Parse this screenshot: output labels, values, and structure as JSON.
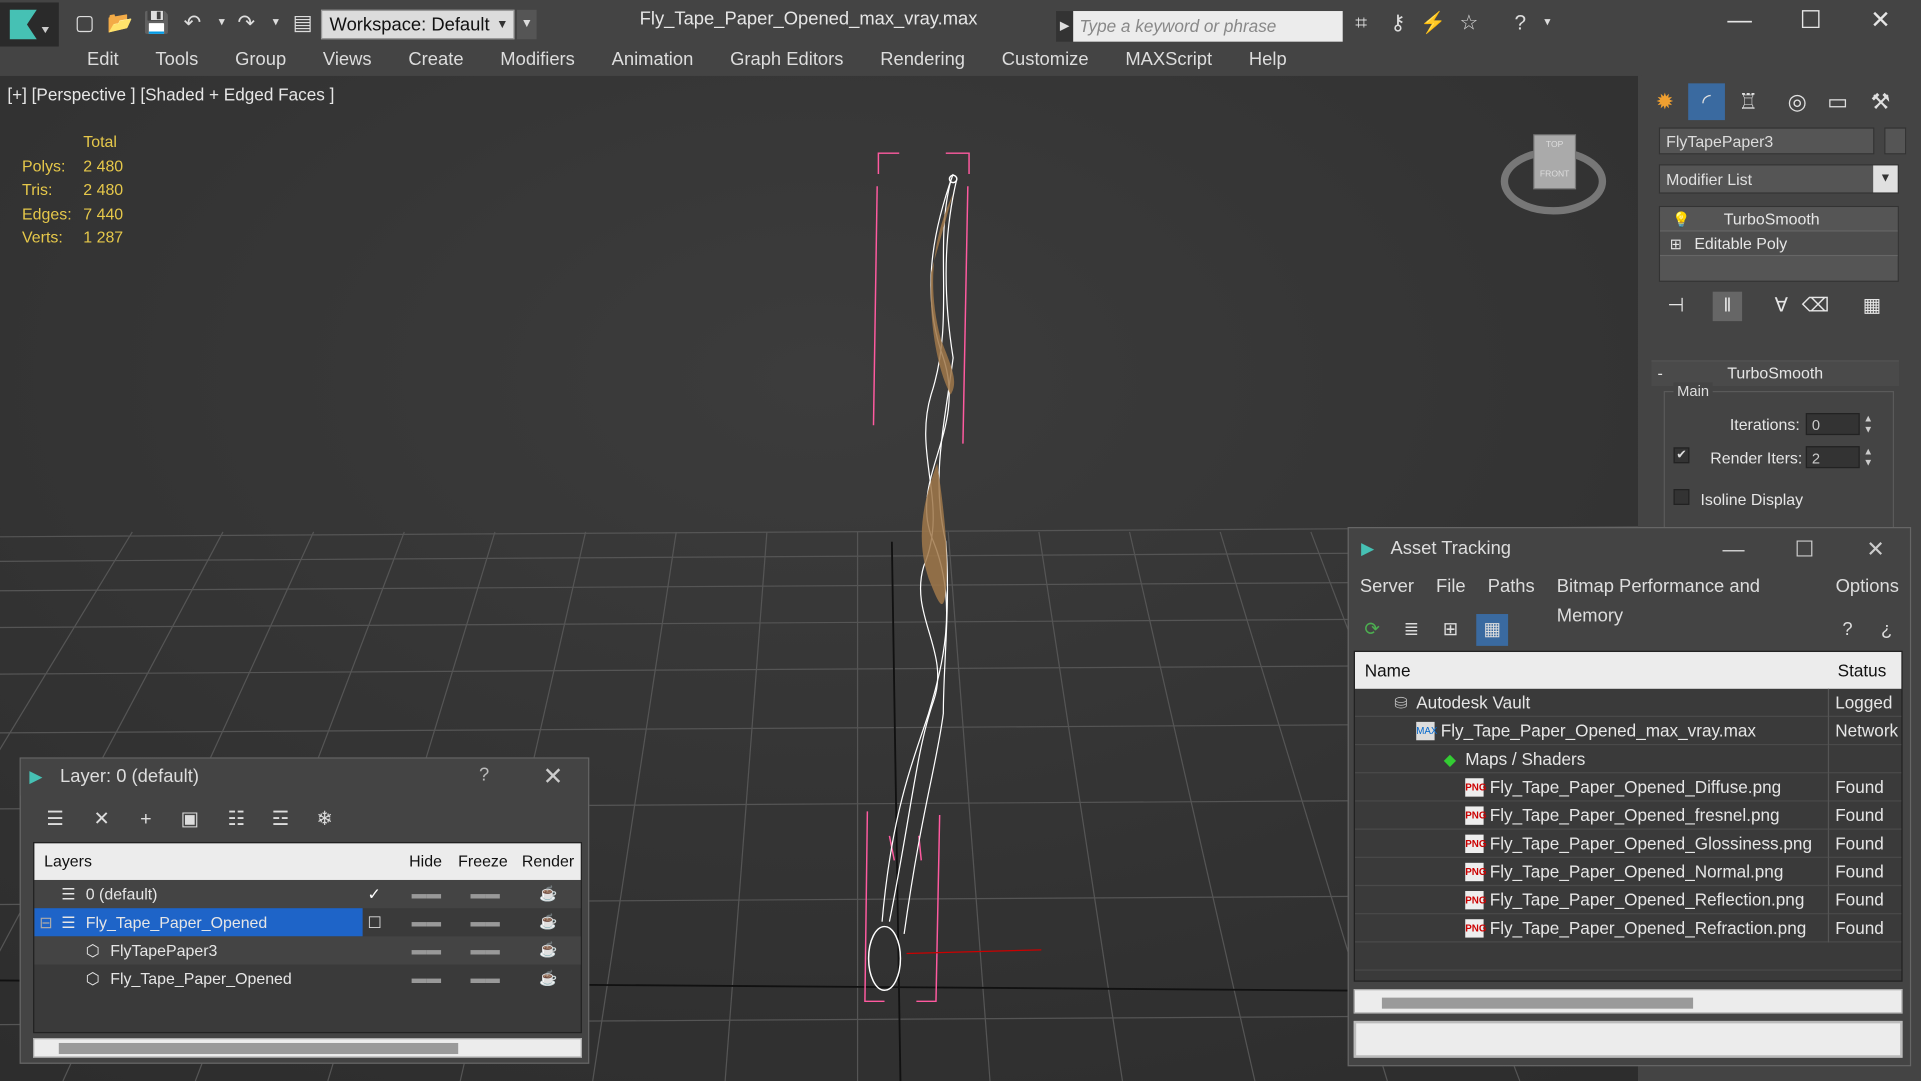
{
  "titlebar": {
    "workspace_label": "Workspace: Default",
    "doc_title": "Fly_Tape_Paper_Opened_max_vray.max",
    "search_placeholder": "Type a keyword or phrase"
  },
  "menu": [
    "Edit",
    "Tools",
    "Group",
    "Views",
    "Create",
    "Modifiers",
    "Animation",
    "Graph Editors",
    "Rendering",
    "Customize",
    "MAXScript",
    "Help"
  ],
  "viewport": {
    "label": "[+] [Perspective ] [Shaded + Edged Faces ]",
    "stats_header": "Total",
    "stats": [
      {
        "label": "Polys:",
        "value": "2 480"
      },
      {
        "label": "Tris:",
        "value": "2 480"
      },
      {
        "label": "Edges:",
        "value": "7 440"
      },
      {
        "label": "Verts:",
        "value": "1 287"
      }
    ],
    "viewcube_top": "TOP",
    "viewcube_front": "FRONT"
  },
  "command_panel": {
    "object_name": "FlyTapePaper3",
    "modifier_list": "Modifier List",
    "stack": [
      "TurboSmooth",
      "Editable Poly"
    ],
    "rollout_title": "TurboSmooth",
    "group_title": "Main",
    "iterations_label": "Iterations:",
    "iterations_value": "0",
    "render_iters_label": "Render Iters:",
    "render_iters_value": "2",
    "isoline_label": "Isoline Display"
  },
  "layer_dialog": {
    "title": "Layer: 0 (default)",
    "help": "?",
    "columns": [
      "Layers",
      "Hide",
      "Freeze",
      "Render"
    ],
    "rows": [
      {
        "name": "0 (default)",
        "indent": 1,
        "selected": false,
        "current": true
      },
      {
        "name": "Fly_Tape_Paper_Opened",
        "indent": 1,
        "selected": true,
        "current": false
      },
      {
        "name": "FlyTapePaper3",
        "indent": 2,
        "selected": false,
        "current": false
      },
      {
        "name": "Fly_Tape_Paper_Opened",
        "indent": 2,
        "selected": false,
        "current": false
      }
    ]
  },
  "asset_dialog": {
    "title": "Asset Tracking",
    "menu": [
      "Server",
      "File",
      "Paths",
      "Bitmap Performance and Memory",
      "Options"
    ],
    "columns": [
      "Name",
      "Status"
    ],
    "rows": [
      {
        "name": "Autodesk Vault",
        "status": "Logged",
        "indent": 0,
        "icon": "vault-icon"
      },
      {
        "name": "Fly_Tape_Paper_Opened_max_vray.max",
        "status": "Network",
        "indent": 1,
        "icon": "max-file-icon"
      },
      {
        "name": "Maps / Shaders",
        "status": "",
        "indent": 2,
        "icon": "maps-folder-icon"
      },
      {
        "name": "Fly_Tape_Paper_Opened_Diffuse.png",
        "status": "Found",
        "indent": 3,
        "icon": "png-icon"
      },
      {
        "name": "Fly_Tape_Paper_Opened_fresnel.png",
        "status": "Found",
        "indent": 3,
        "icon": "png-icon"
      },
      {
        "name": "Fly_Tape_Paper_Opened_Glossiness.png",
        "status": "Found",
        "indent": 3,
        "icon": "png-icon"
      },
      {
        "name": "Fly_Tape_Paper_Opened_Normal.png",
        "status": "Found",
        "indent": 3,
        "icon": "png-icon"
      },
      {
        "name": "Fly_Tape_Paper_Opened_Reflection.png",
        "status": "Found",
        "indent": 3,
        "icon": "png-icon"
      },
      {
        "name": "Fly_Tape_Paper_Opened_Refraction.png",
        "status": "Found",
        "indent": 3,
        "icon": "png-icon"
      }
    ]
  },
  "colors": {
    "stats_text": "#e6c84a",
    "selection": "#1e64c8",
    "bbox": "#ff5aa0",
    "tape": "#a0784a"
  }
}
